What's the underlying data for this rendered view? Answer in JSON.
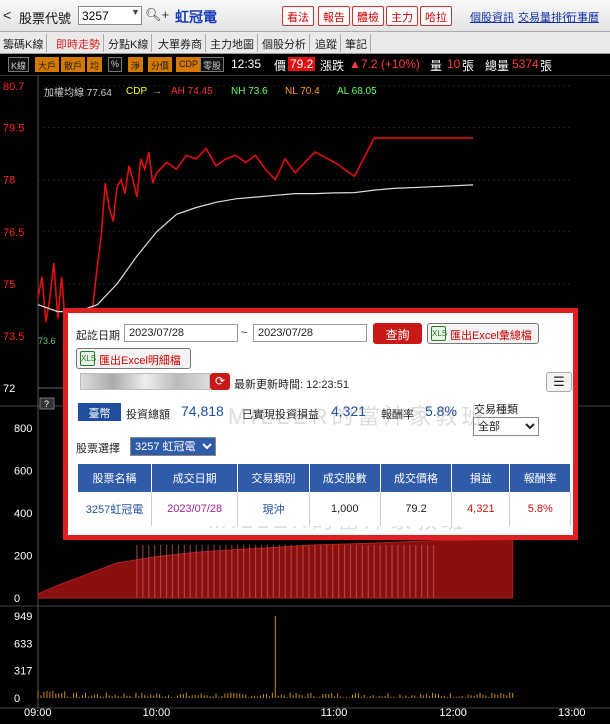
{
  "topbar": {
    "back_label": "<",
    "code_label": "股票代號",
    "code_value": "3257",
    "stock_name": "虹冠電",
    "buttons": [
      "看法",
      "報告",
      "體檢",
      "主力",
      "哈拉"
    ],
    "links": [
      "個股資訊",
      "交易量排行",
      "行事曆"
    ]
  },
  "tabs": [
    "籌碼K線",
    "即時走勢",
    "分點K線",
    "大單券商",
    "主力地圖",
    "個股分析",
    "追蹤",
    "筆記"
  ],
  "active_tab": 1,
  "quote": {
    "modes": [
      "K線",
      "大戶",
      "散戶",
      "均",
      "%",
      "淨",
      "分價",
      "CDP",
      "零股"
    ],
    "time": "12:35",
    "price_label": "價",
    "price": "79.2",
    "change_label": "漲跌",
    "change": "▲7.2 (+10%)",
    "volume_label": "量",
    "volume": "10",
    "volume_unit": "張",
    "total_label": "總量",
    "total": "5374",
    "total_unit": "張"
  },
  "legend": {
    "avg_line": "加權均線 77.64",
    "cdp": "CDP",
    "ah": "AH 74.45",
    "nh": "NH 73.6",
    "nl": "NL 70.4",
    "al": "AL 68.05"
  },
  "chart_data": [
    {
      "type": "line",
      "x_ticks": [
        "09:00",
        "10:00",
        "11:00",
        "12:00",
        "13:00"
      ],
      "y_ticks": [
        "80.7",
        "79.5",
        "78",
        "76.5",
        "75",
        "73.5",
        "72"
      ],
      "ylim": [
        72,
        80.7
      ],
      "marker": "73.6",
      "series": [
        {
          "name": "price",
          "color": "#e01010",
          "x": [
            0,
            2,
            4,
            6,
            8,
            10,
            12,
            14,
            16,
            18,
            20,
            22,
            24,
            26,
            28,
            30,
            32,
            34,
            36,
            38,
            40,
            42,
            44,
            46,
            48,
            50,
            52,
            54,
            56,
            58,
            60,
            65,
            70,
            75,
            80,
            85,
            90,
            95,
            100,
            105,
            110,
            115,
            120,
            125,
            130,
            140,
            150,
            160,
            170,
            180,
            200,
            220
          ],
          "values": [
            74.6,
            75.2,
            73.9,
            74.6,
            75.6,
            74.0,
            75.2,
            73.7,
            74.2,
            73.4,
            74.0,
            73.7,
            74.1,
            73.5,
            74.5,
            75.5,
            76.4,
            77.9,
            77.2,
            76.8,
            77.8,
            78.0,
            77.6,
            78.4,
            78.0,
            77.5,
            78.6,
            78.3,
            78.8,
            77.9,
            78.2,
            78.5,
            78.3,
            78.7,
            78.6,
            78.9,
            78.4,
            78.6,
            78.7,
            78.5,
            78.7,
            78.3,
            78.0,
            78.6,
            78.2,
            78.8,
            78.5,
            78.1,
            79.2,
            79.2,
            79.2,
            79.2
          ]
        },
        {
          "name": "avg",
          "color": "#dddddd",
          "x": [
            0,
            10,
            20,
            30,
            40,
            50,
            60,
            70,
            80,
            90,
            100,
            110,
            120,
            130,
            140,
            150,
            160,
            170,
            180,
            200,
            220
          ],
          "values": [
            74.4,
            74.2,
            74.2,
            74.4,
            75.0,
            75.8,
            76.5,
            77.0,
            77.2,
            77.35,
            77.45,
            77.5,
            77.55,
            77.6,
            77.6,
            77.62,
            77.63,
            77.7,
            77.75,
            77.8,
            77.85
          ]
        }
      ]
    },
    {
      "type": "area",
      "y_ticks": [
        "800",
        "600",
        "400",
        "200",
        "0"
      ],
      "ylim": [
        0,
        800
      ],
      "note": "cumulative volume"
    },
    {
      "type": "bar",
      "y_ticks": [
        "949",
        "633",
        "317",
        "0"
      ],
      "ylim": [
        0,
        949
      ]
    }
  ],
  "dialog": {
    "date_label": "起訖日期",
    "date_from": "2023/07/28",
    "tilde": "~",
    "date_to": "2023/07/28",
    "query_button": "查詢",
    "export_summary": "匯出Excel彙總檔",
    "export_detail": "匯出Excel明細檔",
    "update_label": "最新更新時間: 12:23:51",
    "market": "臺幣",
    "invest_label": "投資總額",
    "invest_value": "74,818",
    "realized_label": "已實現投資損益",
    "realized_value": "4,321",
    "roi_label": "報酬率",
    "roi_value": "5.8%",
    "trade_type_label": "交易種類",
    "trade_type_value": "全部",
    "stock_select_label": "股票選擇",
    "stock_select_value": "3257 虹冠電",
    "watermark": "MILLER的當沖家教班",
    "table": {
      "headers": [
        "股票名稱",
        "成交日期",
        "交易類別",
        "成交股數",
        "成交價格",
        "損益",
        "報酬率"
      ],
      "rows": [
        [
          "3257虹冠電",
          "2023/07/28",
          "現沖",
          "1,000",
          "79.2",
          "4,321",
          "5.8%"
        ]
      ]
    }
  }
}
